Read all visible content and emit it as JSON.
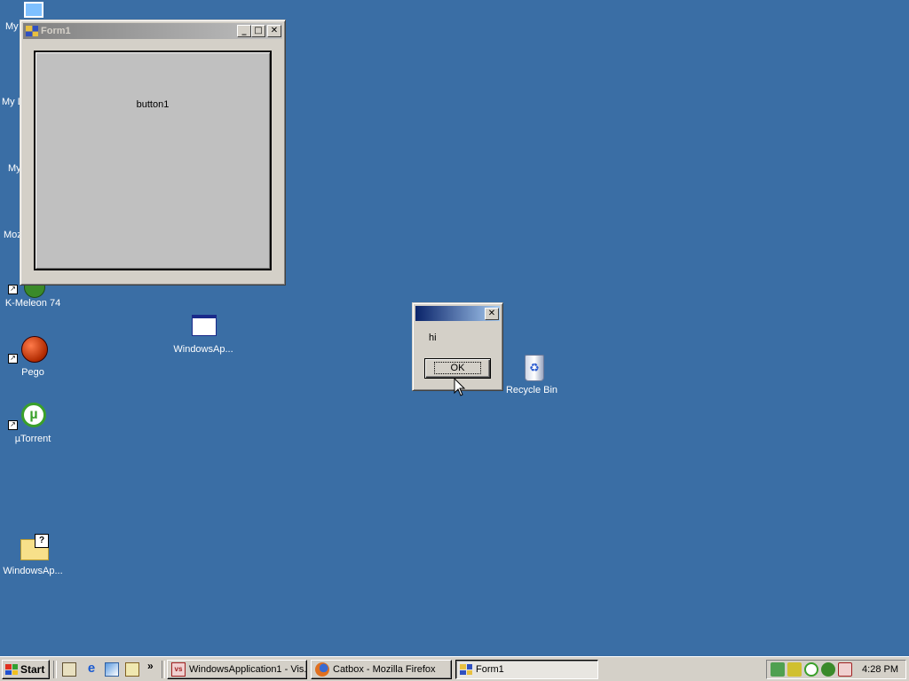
{
  "desktop": {
    "icons": [
      {
        "label": "My",
        "icon": "computer-icon"
      },
      {
        "label": "My D",
        "icon": "documents-icon"
      },
      {
        "label": "My",
        "icon": "network-icon"
      },
      {
        "label": "Moz",
        "icon": "mozilla-icon"
      },
      {
        "label": "K-Meleon 74",
        "icon": "k-meleon-icon"
      },
      {
        "label": "Pego",
        "icon": "pego-icon"
      },
      {
        "label": "µTorrent",
        "icon": "utorrent-icon"
      },
      {
        "label": "WindowsAp...",
        "icon": "folder-icon"
      },
      {
        "label": "WindowsAp...",
        "icon": "application-window-icon"
      },
      {
        "label": "Recycle Bin",
        "icon": "recycle-bin-icon"
      }
    ]
  },
  "form1": {
    "title": "Form1",
    "button_label": "button1",
    "controls": [
      "_",
      "□",
      "✕"
    ]
  },
  "msgbox": {
    "title": "",
    "message": "hi",
    "ok_label": "OK",
    "close": "✕"
  },
  "taskbar": {
    "start_label": "Start",
    "chevron": "»",
    "tasks": [
      {
        "label": "WindowsApplication1 - Vis...",
        "icon": "visual-studio-icon",
        "pressed": false
      },
      {
        "label": "Catbox - Mozilla Firefox",
        "icon": "firefox-icon",
        "pressed": false
      },
      {
        "label": "Form1",
        "icon": "form-icon",
        "pressed": true
      }
    ],
    "clock": "4:28 PM"
  },
  "colors": {
    "desktop": "#3a6ea5",
    "active_title": "#0a246a",
    "inactive_title": "#808080"
  }
}
